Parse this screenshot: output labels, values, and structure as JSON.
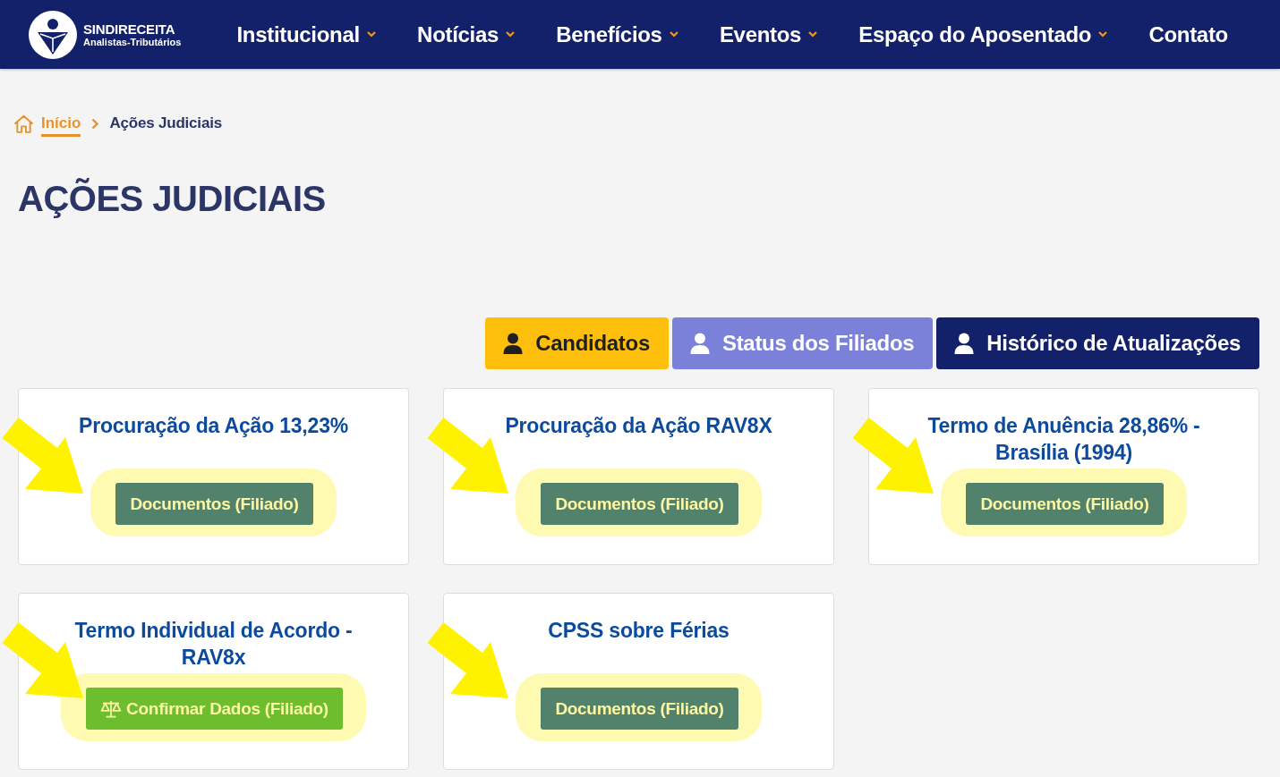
{
  "header": {
    "logo": {
      "name": "SINDIRECEITA",
      "subtitle": "Analistas-Tributários"
    },
    "nav": [
      {
        "label": "Institucional",
        "has_dropdown": true
      },
      {
        "label": "Notícias",
        "has_dropdown": true
      },
      {
        "label": "Benefícios",
        "has_dropdown": true
      },
      {
        "label": "Eventos",
        "has_dropdown": true
      },
      {
        "label": "Espaço do Aposentado",
        "has_dropdown": true
      },
      {
        "label": "Contato",
        "has_dropdown": false
      }
    ]
  },
  "breadcrumb": [
    {
      "label": "Início",
      "kind": "home"
    },
    {
      "label": "Ações Judiciais",
      "kind": "current"
    }
  ],
  "page_title": "AÇÕES JUDICIAIS",
  "tabs": [
    {
      "label": "Candidatos",
      "color": "#fdbf0b"
    },
    {
      "label": "Status dos Filiados",
      "color": "#7b80d9"
    },
    {
      "label": "Histórico de Atualizações",
      "color": "#13216a"
    }
  ],
  "cards": [
    {
      "title": "Procuração da Ação 13,23%",
      "highlighted": true,
      "button": {
        "label": "Documentos (Filiado)",
        "kind": "documents"
      }
    },
    {
      "title": "Procuração da Ação RAV8X",
      "highlighted": true,
      "button": {
        "label": "Documentos (Filiado)",
        "kind": "documents"
      }
    },
    {
      "title": "Termo de Anuência 28,86% - Brasília (1994)",
      "highlighted": true,
      "button": {
        "label": "Documentos (Filiado)",
        "kind": "documents"
      }
    },
    {
      "title": "Termo Individual de Acordo - RAV8x",
      "highlighted": true,
      "button": {
        "label": "Confirmar Dados (Filiado)",
        "kind": "confirm"
      }
    },
    {
      "title": "CPSS sobre Férias",
      "highlighted": true,
      "button": {
        "label": "Documentos (Filiado)",
        "kind": "documents"
      }
    }
  ]
}
